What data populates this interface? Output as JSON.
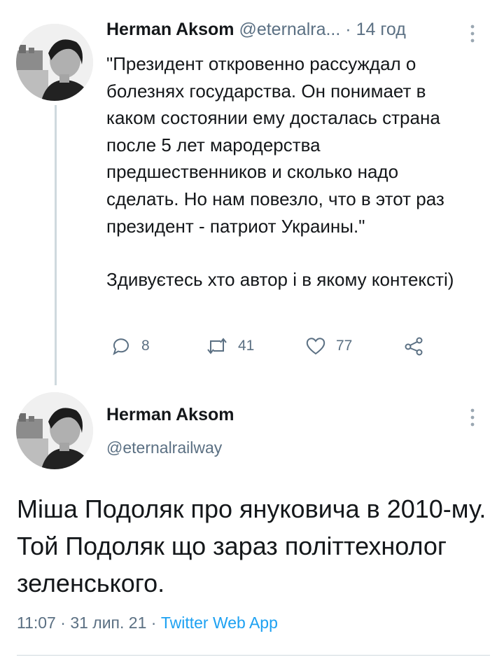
{
  "tweet1": {
    "author_name": "Herman Aksom",
    "handle": "@eternalra...",
    "separator": "·",
    "time": "14 год",
    "text_p1": "\"Президент откровенно рассуждал о болезнях государства. Он понимает в каком состоянии ему досталась страна после 5 лет мародерства предшественников и сколько надо сделать. Но нам повезло, что в этот раз президент - патриот Украины.\"",
    "text_p2": "Здивуєтесь хто автор і в якому контексті)",
    "replies": "8",
    "retweets": "41",
    "likes": "77",
    "icons": {
      "reply": "reply-icon",
      "retweet": "retweet-icon",
      "like": "heart-icon",
      "share": "share-icon",
      "more": "more-vertical-icon"
    }
  },
  "tweet2": {
    "author_name": "Herman Aksom",
    "handle": "@eternalrailway",
    "text": "Міша Подоляк про януковича в 2010-му. Той Подоляк що зараз політтехнолог зеленського.",
    "time": "11:07",
    "separator": "·",
    "date": "31 лип. 21",
    "source": "Twitter Web App"
  },
  "colors": {
    "text": "#14171a",
    "secondary": "#5b7083",
    "link": "#1da1f2",
    "thread_line": "#cfd9de"
  }
}
